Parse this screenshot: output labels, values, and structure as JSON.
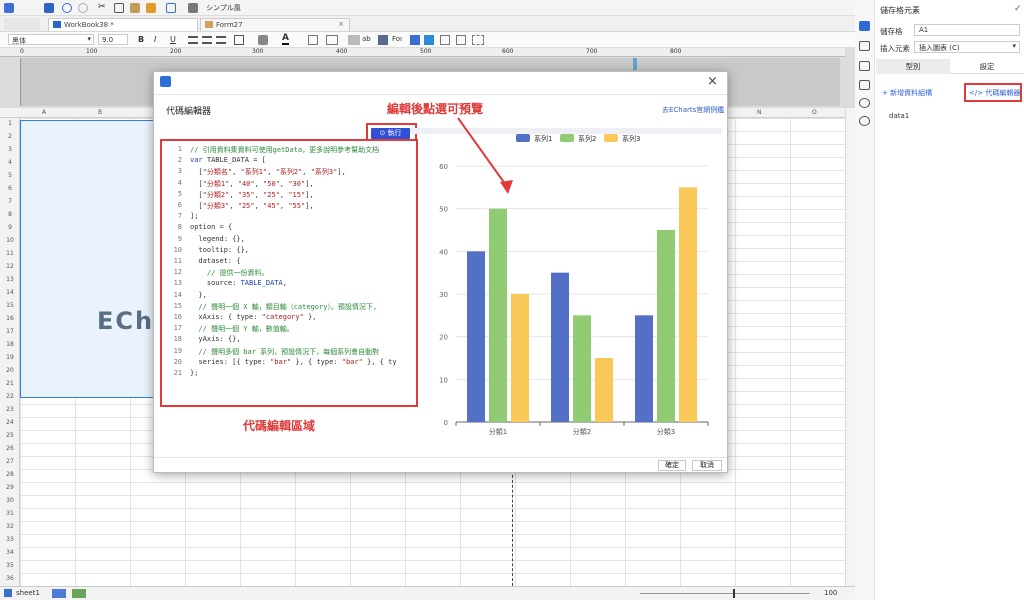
{
  "quickbar": {
    "title": "シンプル風"
  },
  "tabs": [
    {
      "label": "WorkBook38 *"
    },
    {
      "label": "Form27"
    }
  ],
  "format": {
    "font": "黑体",
    "size": "9.0",
    "bold": "B",
    "italic": "I",
    "underline": "U",
    "ab": "ab",
    "fox": "Foı"
  },
  "ruler": {
    "ticks": [
      "0",
      "100",
      "200",
      "300",
      "400",
      "500",
      "600",
      "700",
      "800"
    ]
  },
  "grid": {
    "columns": [
      "A",
      "B",
      "N",
      "O"
    ],
    "rows": [
      "1",
      "2",
      "3",
      "4",
      "5",
      "6",
      "7",
      "8",
      "9",
      "10",
      "11",
      "12",
      "13",
      "14",
      "15",
      "16",
      "17",
      "18",
      "19",
      "20",
      "21",
      "22",
      "23",
      "24",
      "25",
      "26",
      "27",
      "28",
      "29",
      "30",
      "31",
      "32",
      "33",
      "34",
      "35",
      "36"
    ],
    "watermark": "ECh"
  },
  "sheet": {
    "name": "sheet1",
    "zoom": "100"
  },
  "right_panel": {
    "title": "儲存格元素",
    "cell_label": "儲存格",
    "cell_value": "A1",
    "insert_label": "插入元素",
    "insert_value": "插入圖表 (C)",
    "tab_type": "型別",
    "tab_settings": "設定",
    "add_dataset": "+ 新增資料組構",
    "code_editor_btn": "</> 代碼編輯器",
    "dataset_item": "data1"
  },
  "modal": {
    "title": "代碼編輯器",
    "link": "去ECharts官網例鑑",
    "run_label": "執行",
    "ok_label": "確定",
    "cancel_label": "取消"
  },
  "code_lines": [
    [
      {
        "c": "cm",
        "t": "// 引用資料集資料可使用getData，更多說明參考幫助文档"
      }
    ],
    [
      {
        "c": "kw",
        "t": "var"
      },
      {
        "c": "pl",
        "t": " TABLE_DATA = ["
      }
    ],
    [
      {
        "c": "pl",
        "t": "  ["
      },
      {
        "c": "st",
        "t": "\"分類名\""
      },
      {
        "c": "pl",
        "t": ", "
      },
      {
        "c": "st",
        "t": "\"系列1\""
      },
      {
        "c": "pl",
        "t": ", "
      },
      {
        "c": "st",
        "t": "\"系列2\""
      },
      {
        "c": "pl",
        "t": ", "
      },
      {
        "c": "st",
        "t": "\"系列3\""
      },
      {
        "c": "pl",
        "t": "],"
      }
    ],
    [
      {
        "c": "pl",
        "t": "  ["
      },
      {
        "c": "st",
        "t": "\"分類1\""
      },
      {
        "c": "pl",
        "t": ", "
      },
      {
        "c": "st",
        "t": "\"40\""
      },
      {
        "c": "pl",
        "t": ", "
      },
      {
        "c": "st",
        "t": "\"50\""
      },
      {
        "c": "pl",
        "t": ", "
      },
      {
        "c": "st",
        "t": "\"30\""
      },
      {
        "c": "pl",
        "t": "],"
      }
    ],
    [
      {
        "c": "pl",
        "t": "  ["
      },
      {
        "c": "st",
        "t": "\"分類2\""
      },
      {
        "c": "pl",
        "t": ", "
      },
      {
        "c": "st",
        "t": "\"35\""
      },
      {
        "c": "pl",
        "t": ", "
      },
      {
        "c": "st",
        "t": "\"25\""
      },
      {
        "c": "pl",
        "t": ", "
      },
      {
        "c": "st",
        "t": "\"15\""
      },
      {
        "c": "pl",
        "t": "],"
      }
    ],
    [
      {
        "c": "pl",
        "t": "  ["
      },
      {
        "c": "st",
        "t": "\"分類3\""
      },
      {
        "c": "pl",
        "t": ", "
      },
      {
        "c": "st",
        "t": "\"25\""
      },
      {
        "c": "pl",
        "t": ", "
      },
      {
        "c": "st",
        "t": "\"45\""
      },
      {
        "c": "pl",
        "t": ", "
      },
      {
        "c": "st",
        "t": "\"55\""
      },
      {
        "c": "pl",
        "t": "],"
      }
    ],
    [
      {
        "c": "pl",
        "t": "];"
      }
    ],
    [
      {
        "c": "pl",
        "t": "option = {"
      }
    ],
    [
      {
        "c": "pl",
        "t": "  legend: {},"
      }
    ],
    [
      {
        "c": "pl",
        "t": "  tooltip: {},"
      }
    ],
    [
      {
        "c": "pl",
        "t": "  dataset: {"
      }
    ],
    [
      {
        "c": "cm",
        "t": "    // 提供一份資料。"
      }
    ],
    [
      {
        "c": "pl",
        "t": "    source: "
      },
      {
        "c": "kw",
        "t": "TABLE_DATA"
      },
      {
        "c": "pl",
        "t": ","
      }
    ],
    [
      {
        "c": "pl",
        "t": "  },"
      }
    ],
    [
      {
        "c": "cm",
        "t": "  // 聲明一個 X 軸，類目軸（category）。預設情況下,"
      }
    ],
    [
      {
        "c": "pl",
        "t": "  xAxis: { type: "
      },
      {
        "c": "st",
        "t": "\"category\""
      },
      {
        "c": "pl",
        "t": " },"
      }
    ],
    [
      {
        "c": "cm",
        "t": "  // 聲明一個 Y 軸，數值軸。"
      }
    ],
    [
      {
        "c": "pl",
        "t": "  yAxis: {},"
      }
    ],
    [
      {
        "c": "cm",
        "t": "  // 聲明多個 bar 系列，預設情況下，每個系列會自動對"
      }
    ],
    [
      {
        "c": "pl",
        "t": "  series: [{ type: "
      },
      {
        "c": "st",
        "t": "\"bar\""
      },
      {
        "c": "pl",
        "t": " }, { type: "
      },
      {
        "c": "st",
        "t": "\"bar\""
      },
      {
        "c": "pl",
        "t": " }, { ty"
      }
    ],
    [
      {
        "c": "pl",
        "t": "};"
      }
    ]
  ],
  "annotations": {
    "preview": "編輯後點選可預覽",
    "code_area": "代碼編輯區域"
  },
  "chart_data": {
    "type": "bar",
    "categories": [
      "分類1",
      "分類2",
      "分類3"
    ],
    "series": [
      {
        "name": "系列1",
        "values": [
          40,
          35,
          25
        ],
        "color": "#5470c6"
      },
      {
        "name": "系列2",
        "values": [
          50,
          25,
          45
        ],
        "color": "#91cc75"
      },
      {
        "name": "系列3",
        "values": [
          30,
          15,
          55
        ],
        "color": "#fac858"
      }
    ],
    "yticks": [
      "0",
      "10",
      "20",
      "30",
      "40",
      "50",
      "60"
    ],
    "ylim": [
      0,
      60
    ],
    "legend": "top-center",
    "grid": true
  }
}
